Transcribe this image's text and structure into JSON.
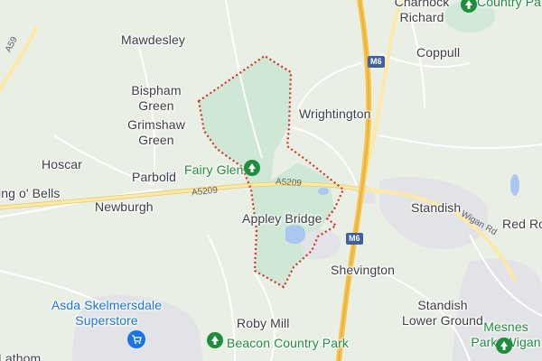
{
  "map": {
    "colors": {
      "land": "#e9efe4",
      "park": "#cfe8d6",
      "urban": "#e1e3e6",
      "water": "#a9c7f0",
      "motorway": "#f6c34a",
      "a_road": "#fde9a7",
      "boundary": "#d93025"
    },
    "places": [
      {
        "id": "charnock-richard",
        "text": "Charnock\nRichard",
        "style": "town"
      },
      {
        "id": "country-park-ne",
        "text": "Country Pa",
        "style": "park"
      },
      {
        "id": "mawdesley",
        "text": "Mawdesley",
        "style": "town"
      },
      {
        "id": "coppull",
        "text": "Coppull",
        "style": "town"
      },
      {
        "id": "bispham-green",
        "text": "Bispham\nGreen",
        "style": "town"
      },
      {
        "id": "wrightington",
        "text": "Wrightington",
        "style": "town"
      },
      {
        "id": "grimshaw-green",
        "text": "Grimshaw\nGreen",
        "style": "town"
      },
      {
        "id": "fairy-glen",
        "text": "Fairy Glen",
        "style": "park"
      },
      {
        "id": "hoscar",
        "text": "Hoscar",
        "style": "town"
      },
      {
        "id": "parbold",
        "text": "Parbold",
        "style": "town"
      },
      {
        "id": "ring-o-bells",
        "text": "ing o' Bells",
        "style": "town"
      },
      {
        "id": "newburgh",
        "text": "Newburgh",
        "style": "town"
      },
      {
        "id": "appley-bridge",
        "text": "Appley Bridge",
        "style": "town"
      },
      {
        "id": "standish",
        "text": "Standish",
        "style": "town"
      },
      {
        "id": "red-rock",
        "text": "Red Ro",
        "style": "town"
      },
      {
        "id": "shevington",
        "text": "Shevington",
        "style": "town"
      },
      {
        "id": "asda",
        "text": "Asda Skelmersdale\nSuperstore",
        "style": "shop"
      },
      {
        "id": "standish-lower-ground",
        "text": "Standish\nLower Ground",
        "style": "town"
      },
      {
        "id": "roby-mill",
        "text": "Roby Mill",
        "style": "town"
      },
      {
        "id": "beacon-country-park",
        "text": "Beacon Country Park",
        "style": "park"
      },
      {
        "id": "mesnes-park",
        "text": "Mesnes\nPark, Wigan",
        "style": "park"
      },
      {
        "id": "lathom",
        "text": "Lathom",
        "style": "town"
      }
    ],
    "roads": [
      {
        "id": "a59",
        "text": "A59"
      },
      {
        "id": "a5209-west",
        "text": "A5209"
      },
      {
        "id": "a5209-east",
        "text": "A5209"
      },
      {
        "id": "wigan-rd",
        "text": "Wigan Rd"
      }
    ],
    "shields": [
      {
        "id": "m6-north",
        "text": "M6"
      },
      {
        "id": "m6-south",
        "text": "M6"
      }
    ],
    "icons": [
      {
        "id": "fairy-glen-pin",
        "name": "tree-icon"
      },
      {
        "id": "beacon-pin",
        "name": "tree-icon"
      },
      {
        "id": "country-park-pin",
        "name": "tree-icon"
      },
      {
        "id": "mesnes-pin",
        "name": "tree-icon"
      },
      {
        "id": "asda-pin",
        "name": "shopping-cart-icon"
      }
    ]
  }
}
